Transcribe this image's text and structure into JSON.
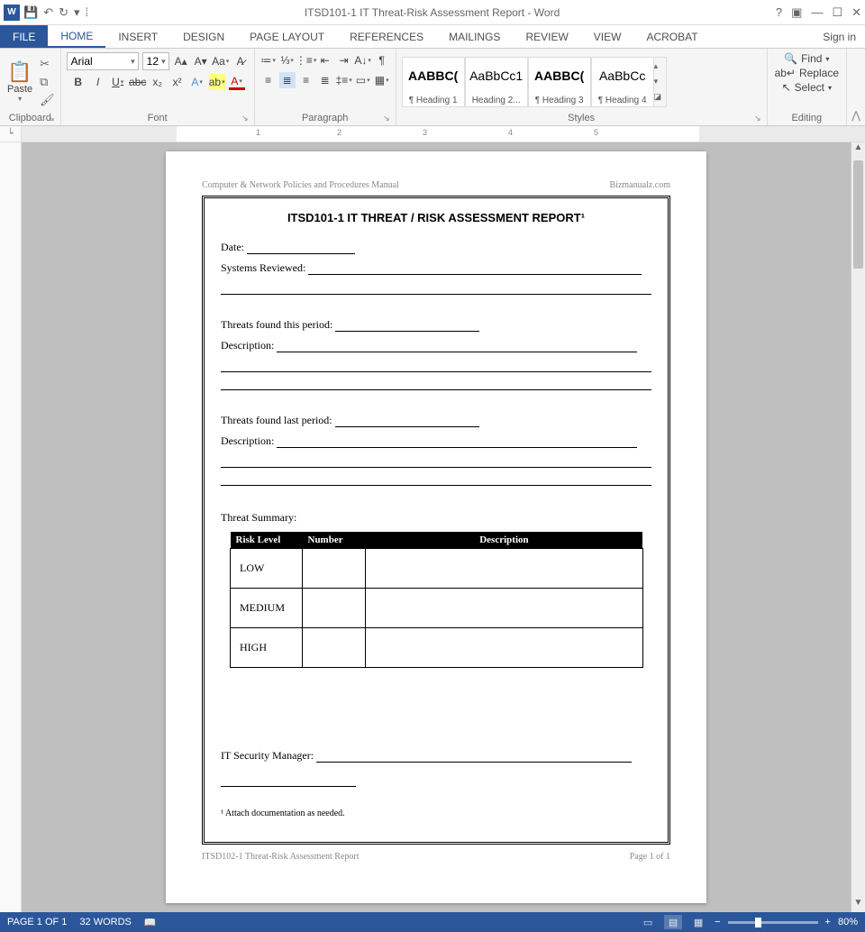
{
  "titlebar": {
    "doc_title": "ITSD101-1 IT Threat-Risk Assessment Report - Word",
    "app_initials": "W"
  },
  "tabs": {
    "file": "FILE",
    "home": "HOME",
    "insert": "INSERT",
    "design": "DESIGN",
    "page_layout": "PAGE LAYOUT",
    "references": "REFERENCES",
    "mailings": "MAILINGS",
    "review": "REVIEW",
    "view": "VIEW",
    "acrobat": "ACROBAT",
    "signin": "Sign in"
  },
  "ribbon": {
    "clipboard": {
      "label": "Clipboard",
      "paste": "Paste"
    },
    "font": {
      "label": "Font",
      "name": "Arial",
      "size": "12"
    },
    "paragraph": {
      "label": "Paragraph"
    },
    "styles": {
      "label": "Styles",
      "items": [
        {
          "preview": "AABBC(",
          "name": "¶ Heading 1"
        },
        {
          "preview": "AaBbCc1",
          "name": "Heading 2..."
        },
        {
          "preview": "AABBC(",
          "name": "¶ Heading 3"
        },
        {
          "preview": "AaBbCc",
          "name": "¶ Heading 4"
        }
      ]
    },
    "editing": {
      "label": "Editing",
      "find": "Find",
      "replace": "Replace",
      "select": "Select"
    }
  },
  "ruler": {
    "ticks": [
      "1",
      "2",
      "3",
      "4",
      "5"
    ]
  },
  "document": {
    "header_left": "Computer & Network Policies and Procedures Manual",
    "header_right": "Bizmanualz.com",
    "title": "ITSD101-1   IT THREAT / RISK ASSESSMENT REPORT¹",
    "date_label": "Date:",
    "systems_label": "Systems Reviewed:",
    "threats_this_label": "Threats found this period:",
    "description_label": "Description:",
    "threats_last_label": "Threats found last period:",
    "summary_label": "Threat Summary:",
    "table": {
      "h1": "Risk Level",
      "h2": "Number",
      "h3": "Description",
      "rows": [
        "LOW",
        "MEDIUM",
        "HIGH"
      ]
    },
    "manager_label": "IT Security Manager:",
    "footnote": "¹ Attach documentation as needed.",
    "footer_left": "ITSD102-1 Threat-Risk Assessment Report",
    "footer_right": "Page 1 of 1"
  },
  "statusbar": {
    "page": "PAGE 1 OF 1",
    "words": "32 WORDS",
    "zoom": "80%"
  }
}
